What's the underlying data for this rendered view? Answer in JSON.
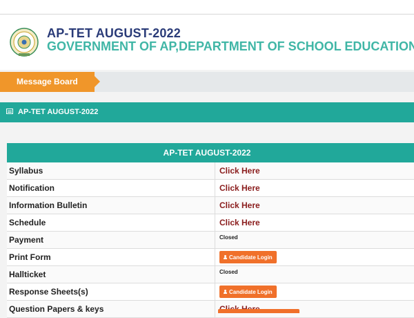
{
  "header": {
    "title": "AP-TET AUGUST-2022",
    "subtitle": "GOVERNMENT OF AP,DEPARTMENT OF SCHOOL EDUCATION."
  },
  "message_board": {
    "label": "Message Board"
  },
  "section": {
    "title": "AP-TET AUGUST-2022"
  },
  "table": {
    "heading": "AP-TET AUGUST-2022",
    "rows": [
      {
        "label": "Syllabus",
        "value": "Click Here",
        "kind": "link"
      },
      {
        "label": "Notification",
        "value": "Click Here",
        "kind": "link"
      },
      {
        "label": "Information Bulletin",
        "value": "Click Here",
        "kind": "link"
      },
      {
        "label": "Schedule",
        "value": "Click Here",
        "kind": "link"
      },
      {
        "label": "Payment",
        "value": "Closed",
        "kind": "text"
      },
      {
        "label": "Print Form",
        "value": "Candidate Login",
        "kind": "button"
      },
      {
        "label": "Hallticket",
        "value": "Closed",
        "kind": "text"
      },
      {
        "label": "Response Sheets(s)",
        "value": "Candidate Login",
        "kind": "button"
      },
      {
        "label": "Question Papers & keys",
        "value": "Click Here",
        "kind": "link"
      }
    ]
  },
  "colors": {
    "title": "#2a3b78",
    "subtitle": "#40b6a6",
    "teal": "#21a89a",
    "orange_tab": "#f0962a",
    "button": "#f0702a",
    "link": "#8a1c1c"
  },
  "icons": {
    "emblem": "ap-emblem-icon",
    "section": "newspaper-icon",
    "button": "user-icon"
  }
}
